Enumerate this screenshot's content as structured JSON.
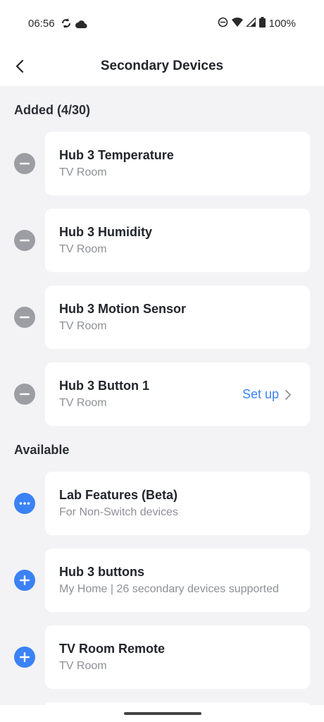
{
  "status": {
    "time": "06:56",
    "battery": "100%"
  },
  "header": {
    "title": "Secondary Devices"
  },
  "added": {
    "title": "Added (4/30)",
    "items": [
      {
        "name": "Hub 3 Temperature",
        "room": "TV Room"
      },
      {
        "name": "Hub 3 Humidity",
        "room": "TV Room"
      },
      {
        "name": "Hub 3 Motion Sensor",
        "room": "TV Room"
      },
      {
        "name": "Hub 3 Button 1",
        "room": "TV Room",
        "action": "Set up"
      }
    ]
  },
  "available": {
    "title": "Available",
    "items": [
      {
        "name": "Lab Features (Beta)",
        "desc": "For Non-Switch devices",
        "icon": "more-icon"
      },
      {
        "name": "Hub 3 buttons",
        "desc": "My Home | 26 secondary devices supported",
        "icon": "plus-icon"
      },
      {
        "name": "TV Room Remote",
        "desc": "TV Room",
        "icon": "plus-icon"
      }
    ]
  },
  "colors": {
    "accent": "#3b82f6",
    "remove": "#9c9ea3",
    "background": "#f3f3f5"
  }
}
